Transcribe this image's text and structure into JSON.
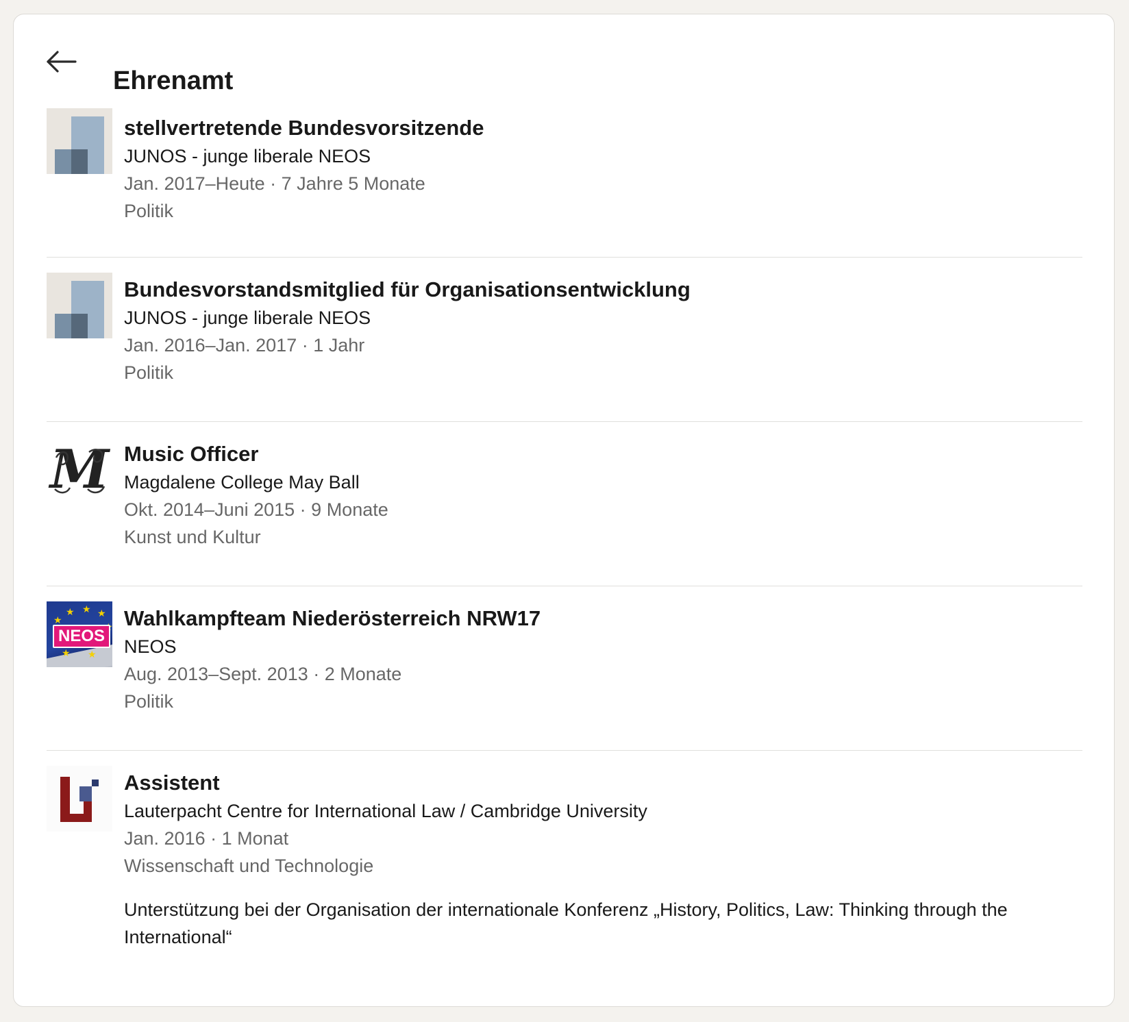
{
  "header": {
    "title": "Ehrenamt",
    "back_icon": "arrow-left-icon"
  },
  "colors": {
    "page_background": "#f4f2ee",
    "card_background": "#ffffff",
    "primary_text": "#191919",
    "secondary_text": "#666666",
    "neos_pink": "#e2187a",
    "neos_blue": "#1f3a8f",
    "lcil_red": "#8b1a1a",
    "lcil_blue": "#2b3a6e"
  },
  "items": [
    {
      "role": "stellvertretende Bundesvorsitzende",
      "organization": "JUNOS - junge liberale NEOS",
      "dates": "Jan. 2017–Heute · 7 Jahre 5 Monate",
      "cause": "Politik",
      "logo": "placeholder-company-logo"
    },
    {
      "role": "Bundesvorstandsmitglied für Organisationsentwicklung",
      "organization": "JUNOS - junge liberale NEOS",
      "dates": "Jan. 2016–Jan. 2017 · 1 Jahr",
      "cause": "Politik",
      "logo": "placeholder-company-logo"
    },
    {
      "role": "Music Officer",
      "organization": "Magdalene College May Ball",
      "dates": "Okt. 2014–Juni 2015 · 9 Monate",
      "cause": "Kunst und Kultur",
      "logo": "magdalene-m-logo"
    },
    {
      "role": "Wahlkampfteam Niederösterreich NRW17",
      "organization": "NEOS",
      "dates": "Aug. 2013–Sept. 2013 · 2 Monate",
      "cause": "Politik",
      "logo": "neos-logo",
      "logo_text": "NEOS"
    },
    {
      "role": "Assistent",
      "organization": "Lauterpacht Centre for International Law / Cambridge University",
      "dates": "Jan. 2016 · 1 Monat",
      "cause": "Wissenschaft und Technologie",
      "description": "Unterstützung bei der Organisation der internationale Konferenz „History, Politics, Law: Thinking through the International“",
      "logo": "lauterpacht-centre-logo"
    }
  ]
}
